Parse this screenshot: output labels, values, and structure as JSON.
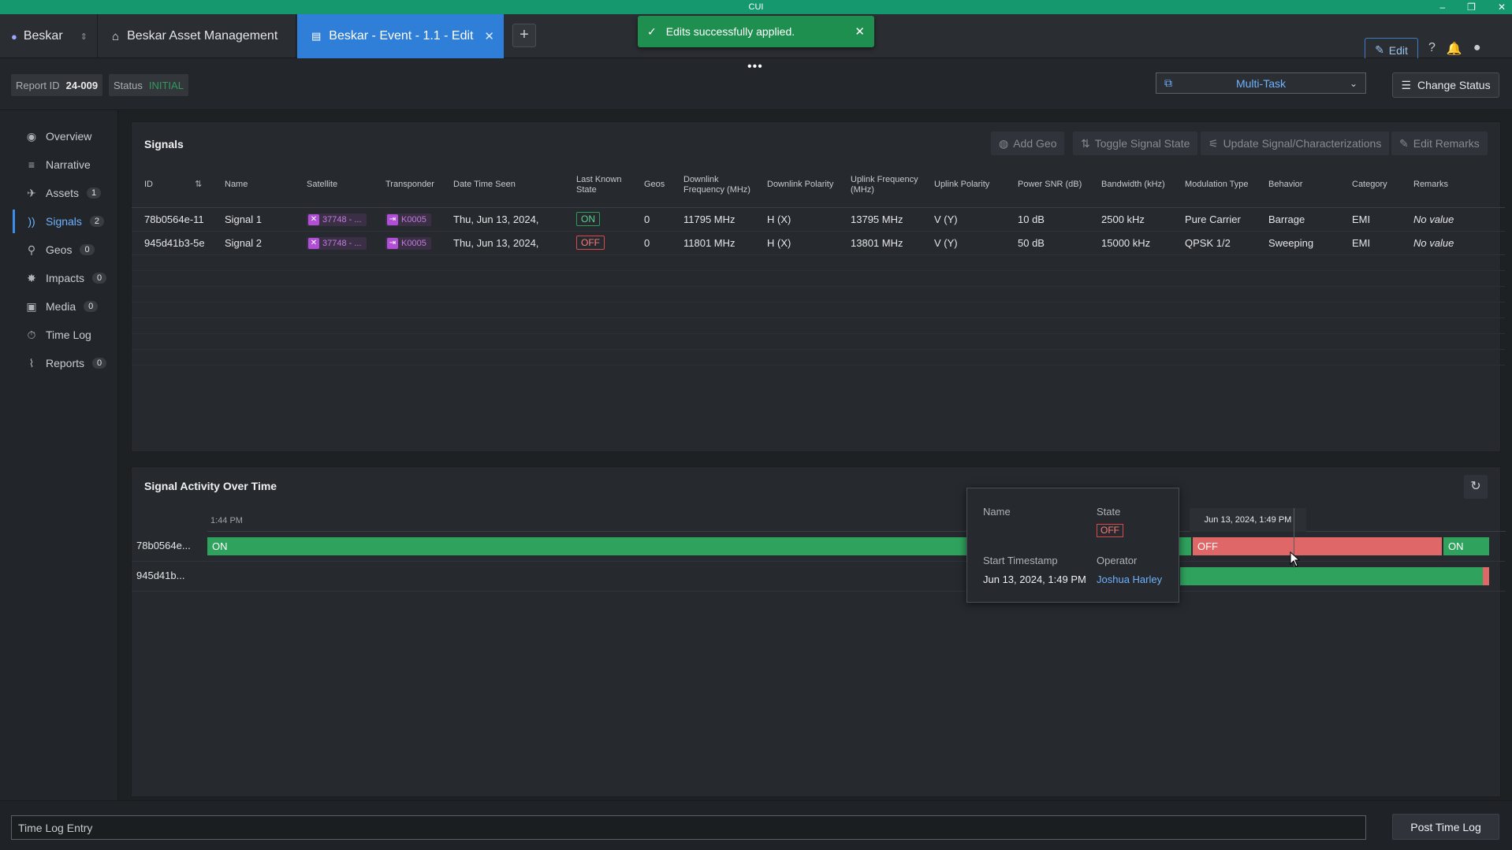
{
  "window": {
    "title": "CUI",
    "controls": [
      "–",
      "❐",
      "✕"
    ]
  },
  "app_switcher": {
    "label": "Beskar"
  },
  "tabs": [
    {
      "label": "Beskar Asset Management",
      "icon": "home-icon"
    },
    {
      "label": "Beskar - Event - 1.1 - Edit",
      "icon": "document-icon",
      "active": true
    }
  ],
  "toast": {
    "message": "Edits successfully applied."
  },
  "header": {
    "edit_label": "Edit"
  },
  "report": {
    "id_label": "Report ID",
    "id_value": "24-009",
    "status_label": "Status",
    "status_value": "INITIAL",
    "multitask_label": "Multi-Task",
    "change_status_label": "Change Status"
  },
  "sidebar": {
    "items": [
      {
        "label": "Overview",
        "icon": "eye-icon",
        "count": ""
      },
      {
        "label": "Narrative",
        "icon": "lines-icon",
        "count": ""
      },
      {
        "label": "Assets",
        "icon": "satellite-icon",
        "count": "1"
      },
      {
        "label": "Signals",
        "icon": "signal-icon",
        "count": "2",
        "active": true
      },
      {
        "label": "Geos",
        "icon": "geo-icon",
        "count": "0"
      },
      {
        "label": "Impacts",
        "icon": "impact-icon",
        "count": "0"
      },
      {
        "label": "Media",
        "icon": "image-icon",
        "count": "0"
      },
      {
        "label": "Time Log",
        "icon": "timer-icon",
        "count": ""
      },
      {
        "label": "Reports",
        "icon": "paperclip-icon",
        "count": "0"
      }
    ]
  },
  "signals": {
    "title": "Signals",
    "toolbar": {
      "add_geo": "Add Geo",
      "toggle_state": "Toggle Signal State",
      "update_signal": "Update Signal/Characterizations",
      "edit_remarks": "Edit Remarks"
    },
    "columns": [
      "ID",
      "Name",
      "Satellite",
      "Transponder",
      "Date Time Seen",
      "Last Known State",
      "Geos",
      "Downlink Frequency (MHz)",
      "Downlink Polarity",
      "Uplink Frequency (MHz)",
      "Uplink Polarity",
      "Power SNR (dB)",
      "Bandwidth (kHz)",
      "Modulation Type",
      "Behavior",
      "Category",
      "Remarks"
    ],
    "rows": [
      {
        "id": "78b0564e-11",
        "name": "Signal 1",
        "satellite": "37748 - ...",
        "transponder": "K0005",
        "seen": "Thu, Jun 13, 2024,",
        "state": "ON",
        "geos": "0",
        "dl_freq": "11795 MHz",
        "dl_pol": "H (X)",
        "ul_freq": "13795 MHz",
        "ul_pol": "V (Y)",
        "snr": "10 dB",
        "bw": "2500 kHz",
        "mod": "Pure Carrier",
        "behavior": "Barrage",
        "category": "EMI",
        "remarks": "No value"
      },
      {
        "id": "945d41b3-5e",
        "name": "Signal 2",
        "satellite": "37748 - ...",
        "transponder": "K0005",
        "seen": "Thu, Jun 13, 2024,",
        "state": "OFF",
        "geos": "0",
        "dl_freq": "11801 MHz",
        "dl_pol": "H (X)",
        "ul_freq": "13801 MHz",
        "ul_pol": "V (Y)",
        "snr": "50 dB",
        "bw": "15000 kHz",
        "mod": "QPSK 1/2",
        "behavior": "Sweeping",
        "category": "EMI",
        "remarks": "No value"
      }
    ]
  },
  "activity": {
    "title": "Signal Activity Over Time",
    "tick_start": "1:44 PM",
    "hover_time": "Jun 13, 2024, 1:49 PM",
    "rows": [
      {
        "label": "78b0564e...",
        "on1": "ON",
        "off": "OFF",
        "on2": "ON"
      },
      {
        "label": "945d41b..."
      }
    ],
    "tooltip": {
      "name_label": "Name",
      "state_label": "State",
      "state_value": "OFF",
      "start_label": "Start Timestamp",
      "start_value": "Jun 13, 2024, 1:49 PM",
      "operator_label": "Operator",
      "operator_value": "Joshua Harley"
    }
  },
  "timelog": {
    "placeholder": "Time Log Entry",
    "post_label": "Post Time Log"
  }
}
